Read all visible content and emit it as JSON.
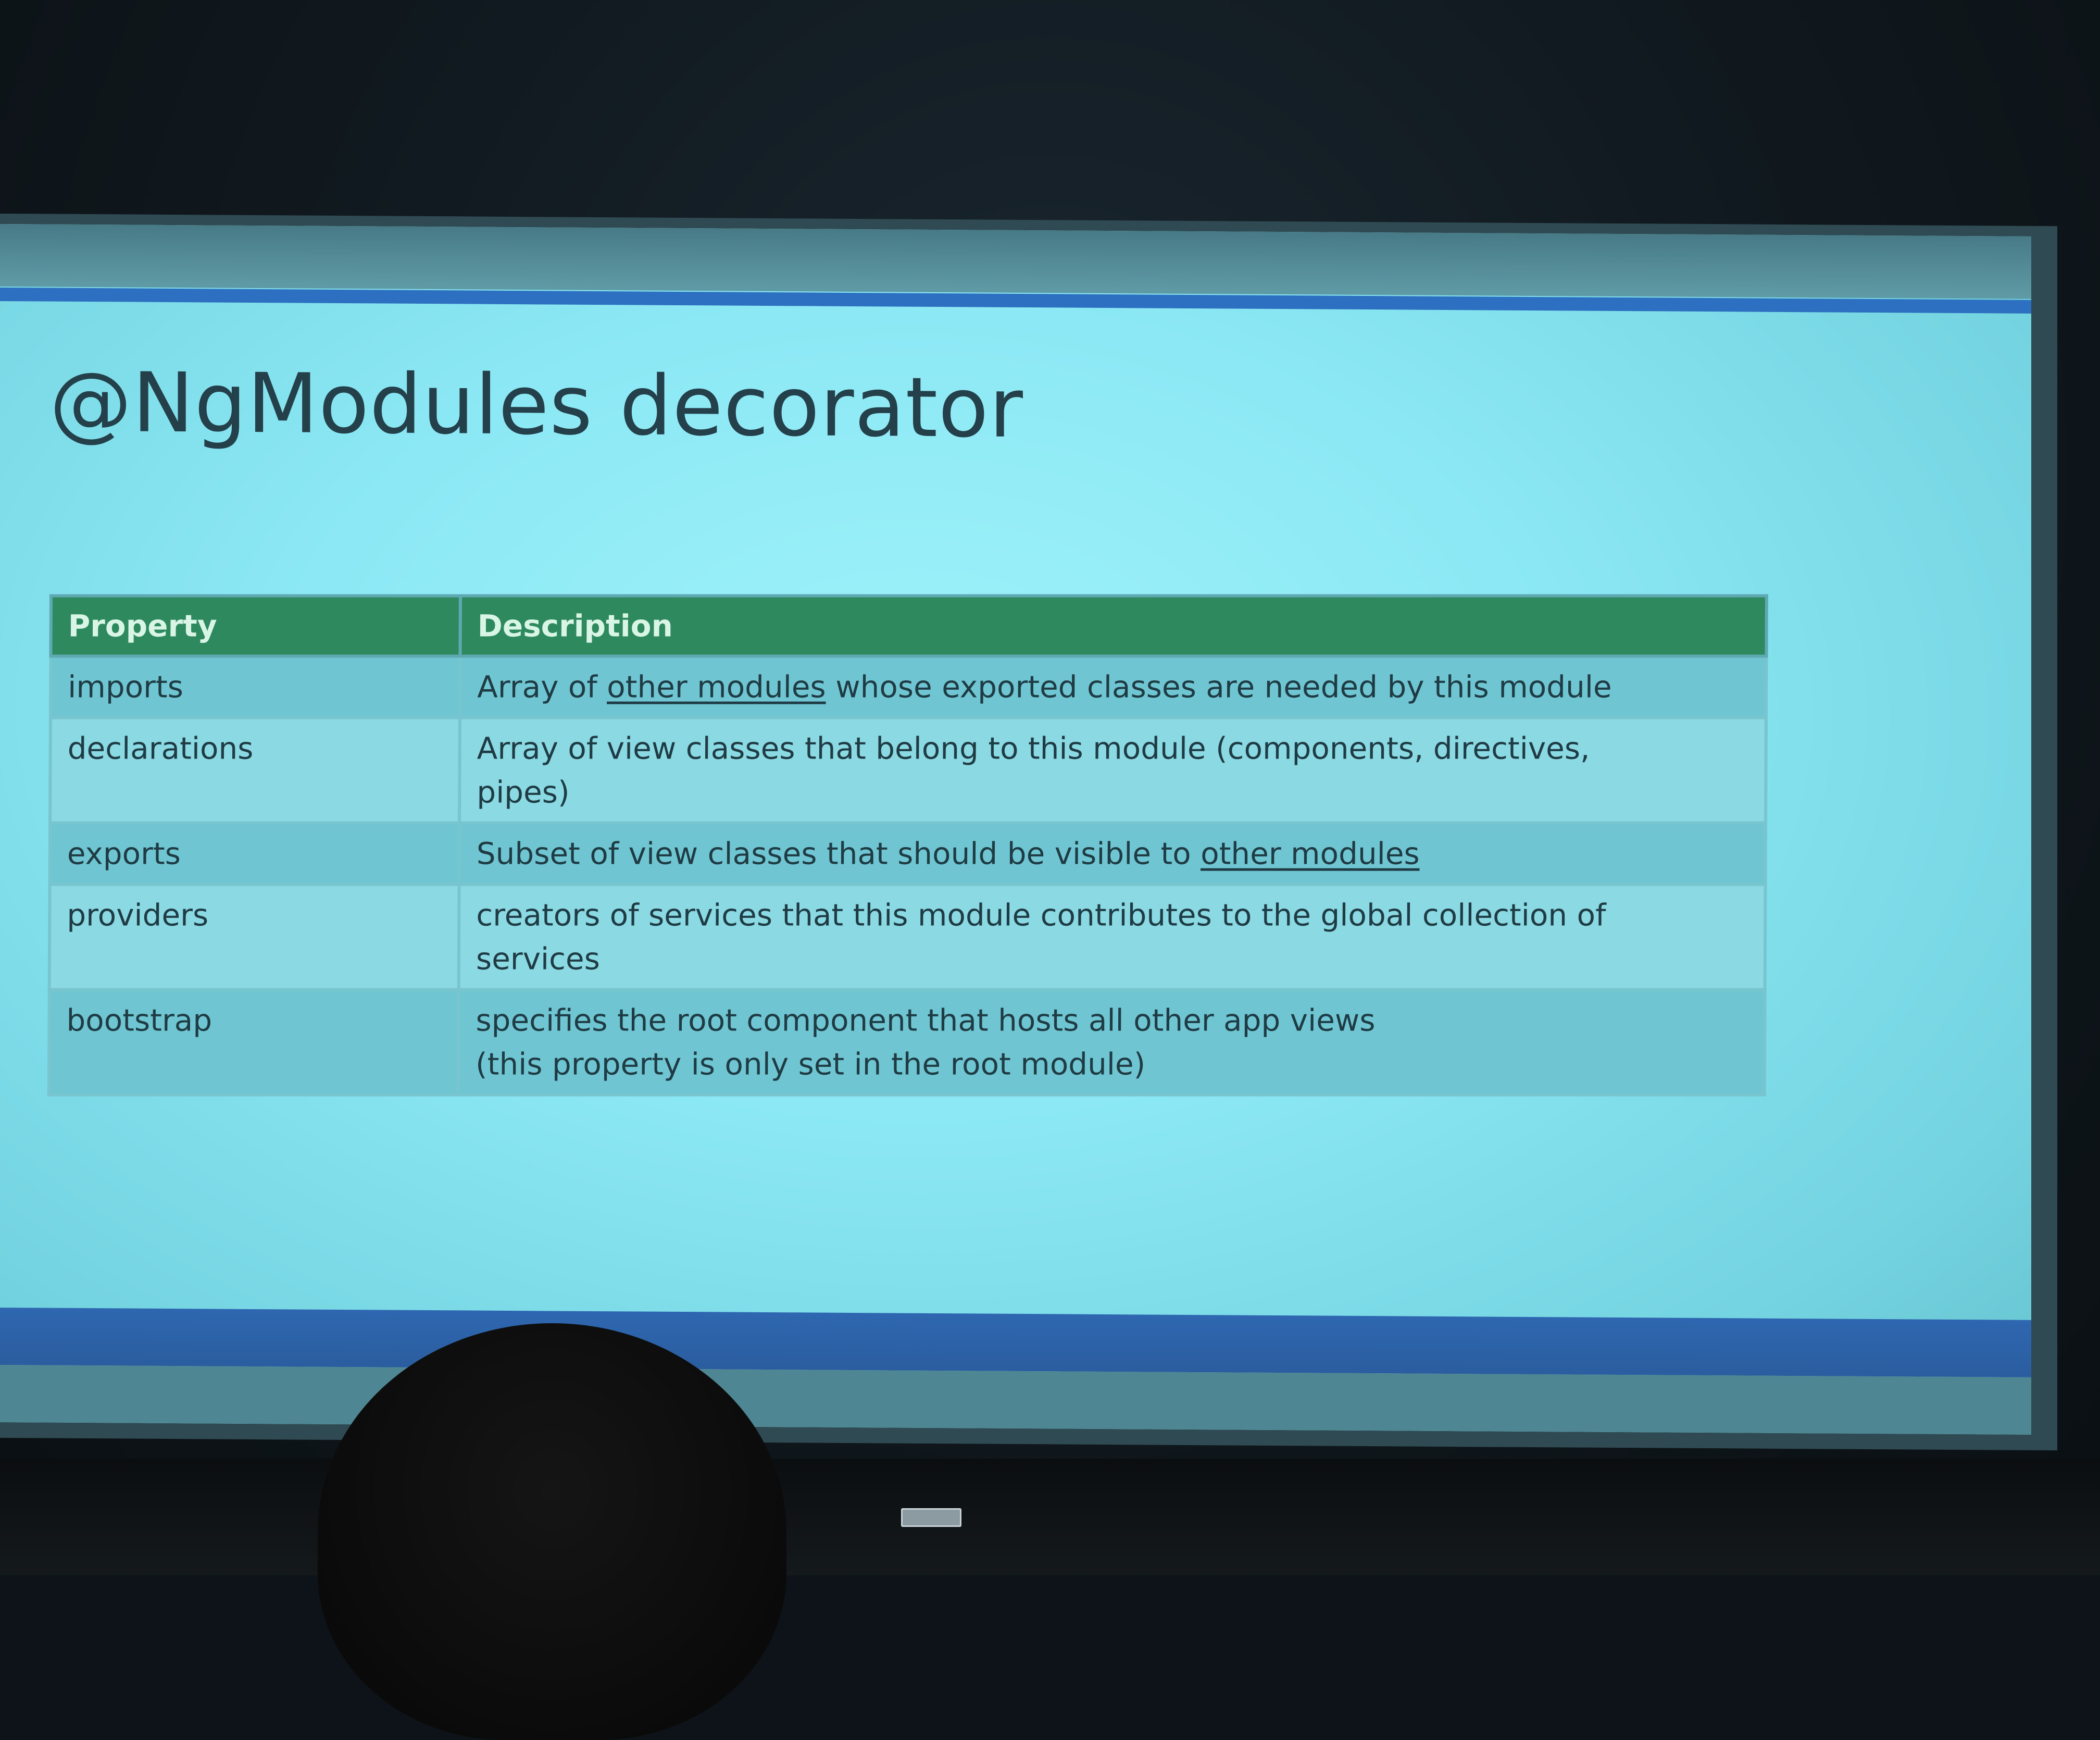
{
  "slide": {
    "title": "@NgModules decorator",
    "table": {
      "headers": [
        "Property",
        "Description"
      ],
      "rows": [
        {
          "property": "imports",
          "description_parts": [
            "Array of ",
            "other modules",
            " whose exported classes are needed by this module"
          ]
        },
        {
          "property": "declarations",
          "description_lines": [
            "Array of view classes that belong to this module (components, directives,",
            "pipes)"
          ]
        },
        {
          "property": "exports",
          "description_parts": [
            "Subset of view classes that should be visible to ",
            "other modules"
          ]
        },
        {
          "property": "providers",
          "description_lines": [
            "creators of services that this module contributes to the global collection of",
            "services"
          ]
        },
        {
          "property": "bootstrap",
          "description_lines": [
            "specifies the root component that hosts all other app views",
            "(this property is only set in the root module)"
          ]
        }
      ]
    }
  },
  "colors": {
    "header_green": "#2e8a5e",
    "slide_bg": "#8be8f4",
    "accent_blue": "#2d6fc0"
  }
}
